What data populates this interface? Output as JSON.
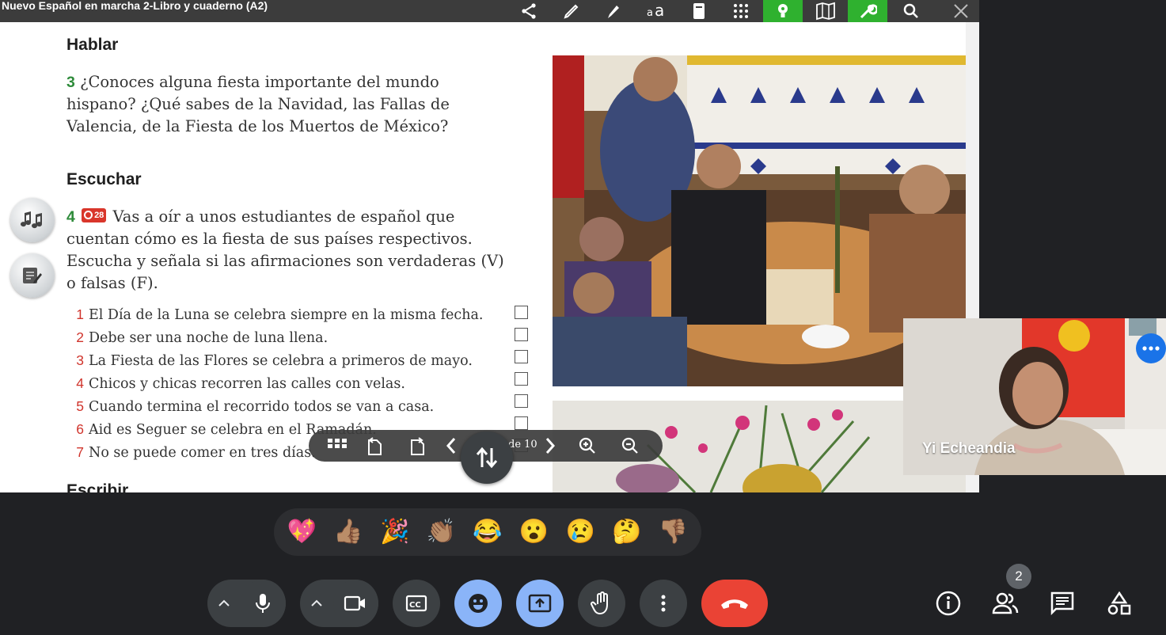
{
  "doc": {
    "title": "Nuevo Español en marcha 2-Libro y cuaderno (A2)",
    "toolbar_icons": [
      "share-icon",
      "pencil-icon",
      "highlighter-icon",
      "text-size-icon",
      "notes-icon",
      "apps-grid-icon",
      "lightbulb-icon",
      "bookmark-book-icon",
      "wrench-icon",
      "search-icon",
      "close-icon"
    ],
    "sections": {
      "hablar": {
        "heading": "Hablar",
        "num": "3",
        "text": "¿Conoces alguna fiesta importante del mundo hispano? ¿Qué sabes de la Navidad, las Fallas de Valencia, de la Fiesta de los Muertos de México?"
      },
      "escuchar": {
        "heading": "Escuchar",
        "num": "4",
        "track": "28",
        "text": "Vas a oír a unos estudiantes de español que cuentan cómo es la fiesta de sus países respectivos. Escucha y señala si las afirmaciones son verdaderas (V) o falsas (F).",
        "items": [
          {
            "n": "1",
            "text": "El Día de la Luna se celebra siempre en la misma fecha."
          },
          {
            "n": "2",
            "text": "Debe ser una noche de luna llena."
          },
          {
            "n": "3",
            "text": "La Fiesta de las Flores se celebra a primeros de mayo."
          },
          {
            "n": "4",
            "text": "Chicos y chicas recorren las calles con velas."
          },
          {
            "n": "5",
            "text": "Cuando termina el recorrido todos se van a casa."
          },
          {
            "n": "6",
            "text": "Aid es Seguer se celebra en el Ramadán."
          },
          {
            "n": "7",
            "text": "No se puede comer en tres días."
          }
        ]
      },
      "escribir": {
        "heading": "Escribir"
      }
    },
    "pager": {
      "page_text": "de 10"
    }
  },
  "video": {
    "name": "Yi Echeandia"
  },
  "reactions": [
    "💖",
    "👍🏽",
    "🎉",
    "👏🏽",
    "😂",
    "😮",
    "😢",
    "🤔",
    "👎🏽"
  ],
  "controls": {
    "participants_count": "2",
    "hangup_color": "#ea4335",
    "active_color": "#8ab4f8"
  }
}
